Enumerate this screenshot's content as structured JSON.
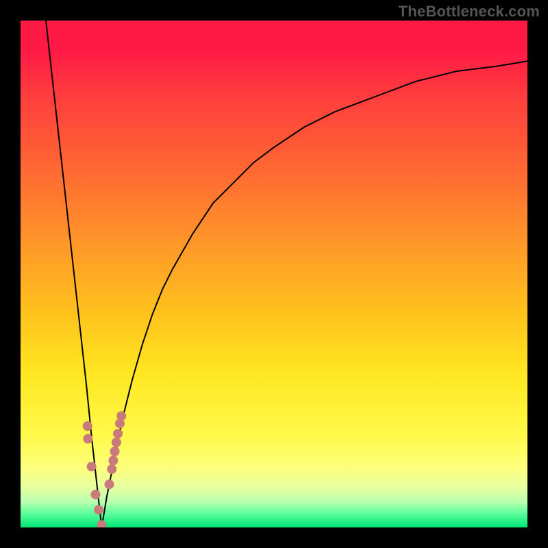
{
  "watermark": "TheBottleneck.com",
  "chart_data": {
    "type": "line",
    "title": "",
    "xlabel": "",
    "ylabel": "",
    "xlim": [
      0,
      100
    ],
    "ylim": [
      0,
      100
    ],
    "grid": false,
    "legend": false,
    "description": "Bottleneck percentage (y) vs. a sweep variable (x). Black curve dips to 0 at the optimal x (~16) and rises toward 100 on both sides. Background gradient encodes severity: green (good, bottom) → yellow → red (bad, top). Pink markers cluster near the minimum.",
    "series": [
      {
        "name": "left_branch",
        "x": [
          5,
          6,
          7,
          8,
          9,
          10,
          11,
          12,
          13,
          14,
          15,
          16
        ],
        "y": [
          100,
          91,
          82,
          73,
          64,
          55,
          46,
          37,
          28,
          18,
          9,
          0
        ]
      },
      {
        "name": "right_branch",
        "x": [
          16,
          17,
          18,
          19,
          20,
          22,
          24,
          26,
          28,
          30,
          34,
          38,
          42,
          46,
          50,
          56,
          62,
          70,
          78,
          86,
          94,
          100
        ],
        "y": [
          0,
          6,
          11,
          16,
          21,
          29,
          36,
          42,
          47,
          51,
          58,
          64,
          68,
          72,
          75,
          79,
          82,
          85,
          88,
          90,
          91,
          92
        ]
      }
    ],
    "markers": {
      "name": "near_optimal_points",
      "x": [
        13.2,
        13.3,
        14.0,
        14.8,
        15.4,
        16.0,
        17.5,
        18.0,
        18.3,
        18.6,
        18.9,
        19.2,
        19.6,
        19.9
      ],
      "y": [
        20.0,
        17.5,
        12.0,
        6.5,
        3.5,
        0.5,
        8.5,
        11.5,
        13.2,
        15.0,
        16.8,
        18.5,
        20.5,
        22.0
      ]
    },
    "colorbar": {
      "orientation": "vertical_gradient_background",
      "stops": [
        {
          "value": 100,
          "color": "#ff1a46"
        },
        {
          "value": 70,
          "color": "#ff9a28"
        },
        {
          "value": 40,
          "color": "#ffe822"
        },
        {
          "value": 15,
          "color": "#fdff7a"
        },
        {
          "value": 0,
          "color": "#00e676"
        }
      ]
    }
  }
}
